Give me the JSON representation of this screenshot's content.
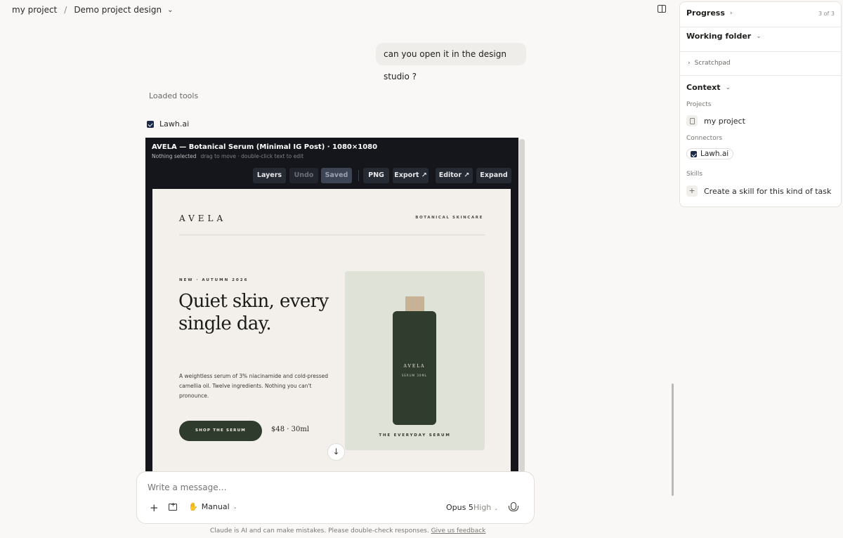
{
  "header": {
    "project": "my project",
    "separator": "/",
    "chat_title": "Demo project design"
  },
  "conversation": {
    "user_message": "can you open it in the design studio ?",
    "loaded_tools_label": "Loaded tools",
    "tool_name": "Lawh.ai"
  },
  "studio": {
    "title": "AVELA — Botanical Serum (Minimal IG Post) · 1080×1080",
    "selection": "Nothing selected",
    "hint": "drag to move · double-click text to edit",
    "toolbar": {
      "layers": "Layers",
      "undo": "Undo",
      "saved": "Saved",
      "png": "PNG",
      "export": "Export ↗",
      "editor": "Editor ↗",
      "expand": "Expand"
    }
  },
  "design": {
    "brand": "AVELA",
    "brand_tag": "BOTANICAL SKINCARE",
    "kicker": "NEW · AUTUMN 2026",
    "headline": "Quiet skin, every single day.",
    "body": "A weightless serum of 3% niacinamide and cold-pressed camellia oil. Twelve ingredients. Nothing you can't pronounce.",
    "cta": "SHOP THE SERUM",
    "price": "$48 · 30ml",
    "bottle_brand": "AVELA",
    "bottle_sub": "SERUM 30ML",
    "card_caption": "THE EVERYDAY SERUM",
    "colors": {
      "background": "#f3f0eb",
      "accent": "#2f3b2c",
      "card": "#dfe3d7",
      "cap": "#c7b296"
    }
  },
  "composer": {
    "placeholder": "Write a message…",
    "mode": "Manual",
    "model": "Opus 5",
    "effort": "High"
  },
  "footer": {
    "disclaimer": "Claude is AI and can make mistakes. Please double-check responses.",
    "feedback_link": "Give us feedback"
  },
  "right_panel": {
    "progress_label": "Progress",
    "progress_count": "3 of 3",
    "working_folder_label": "Working folder",
    "scratchpad_label": "Scratchpad",
    "context_label": "Context",
    "projects_heading": "Projects",
    "project_item": "my project",
    "connectors_heading": "Connectors",
    "connector_item": "Lawh.ai",
    "skills_heading": "Skills",
    "skill_action": "Create a skill for this kind of task"
  }
}
